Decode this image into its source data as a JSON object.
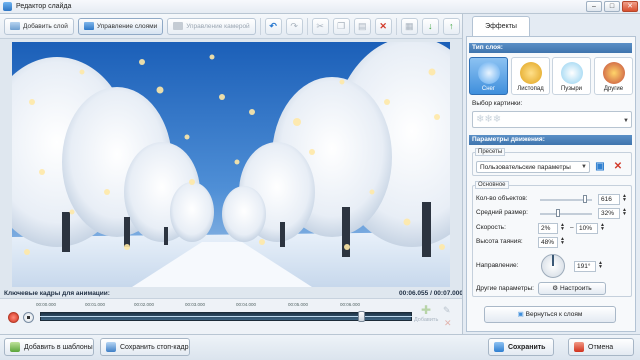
{
  "window": {
    "title": "Редактор слайда",
    "minimize": "–",
    "maximize": "□",
    "close": "✕"
  },
  "toolbar": {
    "add_layer": "Добавить слой",
    "manage_layers": "Управление слоями",
    "manage_camera": "Управление камерой"
  },
  "keyframes": {
    "label": "Ключевые кадры для анимации:",
    "time": "00:06.055 / 00:07.000",
    "ticks": [
      "00:00.000",
      "00:01.000",
      "00:02.000",
      "00:03.000",
      "00:04.000",
      "00:05.000",
      "00:06.000"
    ],
    "playhead_fraction": 0.865,
    "add_label": "Добавить"
  },
  "panel": {
    "tab": "Эффекты",
    "type_header": "Тип слоя:",
    "types": [
      {
        "label": "Снег",
        "selected": true
      },
      {
        "label": "Листопад",
        "selected": false
      },
      {
        "label": "Пузыри",
        "selected": false
      },
      {
        "label": "Другие",
        "selected": false
      }
    ],
    "image_label": "Выбор картинки:",
    "motion_header": "Параметры движения:",
    "presets_title": "Пресеты",
    "preset_value": "Пользовательские параметры",
    "basic_title": "Основное",
    "count_label": "Кол-во объектов:",
    "count_value": "616",
    "size_label": "Средний размер:",
    "size_value": "32%",
    "speed_label": "Скорость:",
    "speed_min": "2%",
    "speed_dash": "–",
    "speed_max": "10%",
    "melt_label": "Высота таяния:",
    "melt_value": "48%",
    "direction_label": "Направление:",
    "direction_value": "191°",
    "other_label": "Другие параметры:",
    "configure_button": "Настроить",
    "back_button": "Вернуться к слоям"
  },
  "bottom": {
    "add_template": "Добавить в шаблоны",
    "save_frame": "Сохранить стоп-кадр",
    "save": "Сохранить",
    "cancel": "Отмена"
  },
  "colors": {
    "accent": "#3f74ad",
    "record": "#d0311d",
    "save_icon": "#2f7fd0",
    "delete_icon": "#d23a2a"
  }
}
